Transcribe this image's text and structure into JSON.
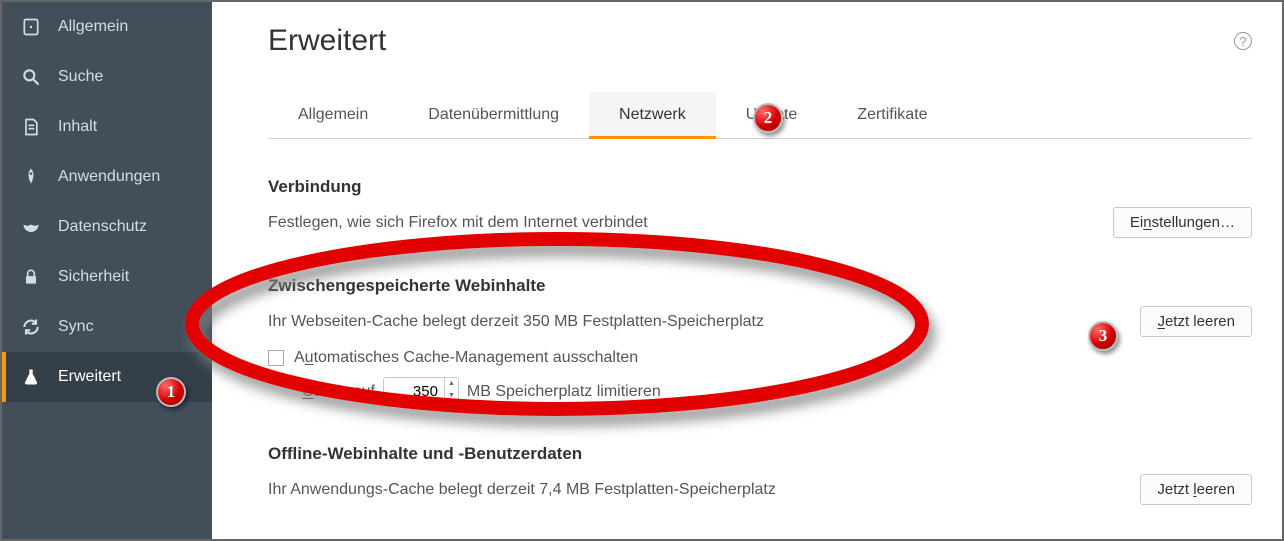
{
  "sidebar": {
    "items": [
      {
        "label": "Allgemein",
        "icon": "general"
      },
      {
        "label": "Suche",
        "icon": "search"
      },
      {
        "label": "Inhalt",
        "icon": "content"
      },
      {
        "label": "Anwendungen",
        "icon": "apps"
      },
      {
        "label": "Datenschutz",
        "icon": "privacy"
      },
      {
        "label": "Sicherheit",
        "icon": "security"
      },
      {
        "label": "Sync",
        "icon": "sync"
      },
      {
        "label": "Erweitert",
        "icon": "advanced"
      }
    ],
    "active": "Erweitert"
  },
  "page_title": "Erweitert",
  "tabs": [
    "Allgemein",
    "Datenübermittlung",
    "Netzwerk",
    "Update",
    "Zertifikate"
  ],
  "selected_tab": "Netzwerk",
  "connection": {
    "title": "Verbindung",
    "desc": "Festlegen, wie sich Firefox mit dem Internet verbindet",
    "button": "Einstellungen…",
    "button_u": "n"
  },
  "cache": {
    "title": "Zwischengespeicherte Webinhalte",
    "desc": "Ihr Webseiten-Cache belegt derzeit 350 MB Festplatten-Speicherplatz",
    "button": "Jetzt leeren",
    "button_u": "J",
    "checkbox_label_pre": "A",
    "checkbox_label_u": "u",
    "checkbox_label_post": "tomatisches Cache-Management ausschalten",
    "cache_pre": "",
    "cache_u": "C",
    "cache_post": "ache auf",
    "cache_value": "350",
    "cache_suffix": "MB Speicherplatz limitieren"
  },
  "offline": {
    "title": "Offline-Webinhalte und -Benutzerdaten",
    "desc": "Ihr Anwendungs-Cache belegt derzeit 7,4 MB Festplatten-Speicherplatz",
    "button": "Jetzt leeren",
    "button_u": "l"
  },
  "annotations": {
    "b1": "1",
    "b2": "2",
    "b3": "3"
  }
}
